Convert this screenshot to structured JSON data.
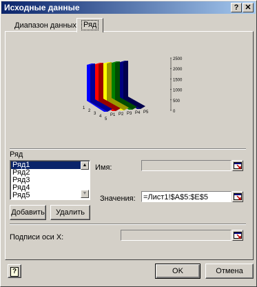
{
  "window": {
    "title": "Исходные данные",
    "help_label": "?",
    "close_label": "✕"
  },
  "tabs": [
    {
      "label": "Диапазон данных",
      "active": false
    },
    {
      "label": "Ряд",
      "active": true
    }
  ],
  "chart_data": {
    "type": "bar",
    "subtype": "3d-area-ribbons",
    "categories": [
      "1",
      "2",
      "3",
      "4",
      "5"
    ],
    "series": [
      {
        "name": "P1",
        "color": "#0000ff"
      },
      {
        "name": "P2",
        "color": "#ff0000"
      },
      {
        "name": "P3",
        "color": "#ffff00"
      },
      {
        "name": "P4",
        "color": "#008000"
      },
      {
        "name": "P5",
        "color": "#000080"
      }
    ],
    "y_ticks": [
      "2500",
      "2000",
      "1500",
      "1000",
      "500",
      "0"
    ],
    "ylim": [
      0,
      2500
    ]
  },
  "series_section": {
    "label": "Ряд",
    "items": [
      "Ряд1",
      "Ряд2",
      "Ряд3",
      "Ряд4",
      "Ряд5"
    ],
    "selected_index": 0,
    "add_button": "Добавить",
    "remove_button": "Удалить",
    "name_label": "Имя:",
    "name_value": "",
    "values_label": "Значения:",
    "values_value": "=Лист1!$A$5:$E$5"
  },
  "x_labels": {
    "label": "Подписи оси X:",
    "value": ""
  },
  "footer": {
    "help_icon": "?",
    "ok_label": "OK",
    "cancel_label": "Отмена"
  },
  "colors": {
    "titlebar_start": "#0a246a",
    "titlebar_end": "#a6caf0",
    "face": "#d4d0c8",
    "selection": "#0a246a"
  }
}
